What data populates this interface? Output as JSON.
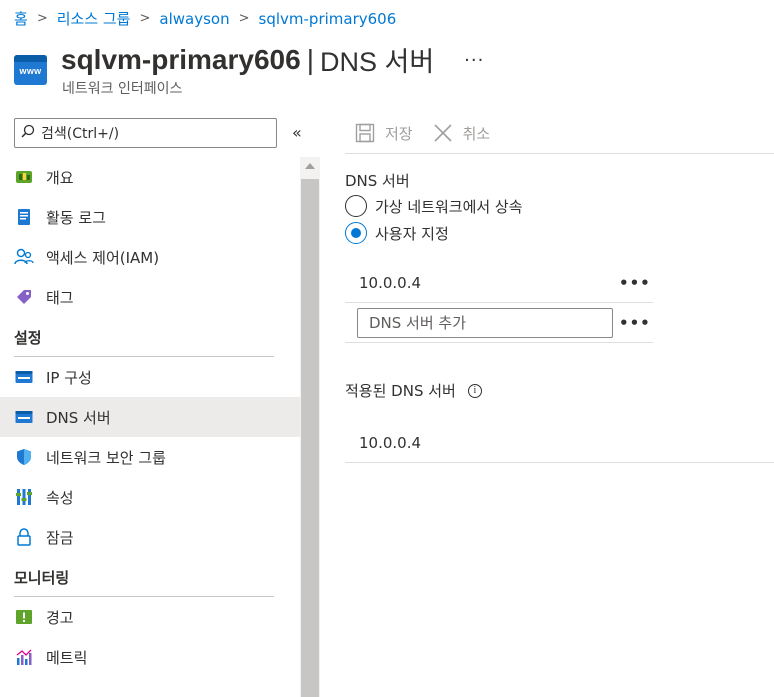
{
  "breadcrumb": {
    "items": [
      "홈",
      "리소스 그룹",
      "alwayson",
      "sqlvm-primary606"
    ]
  },
  "header": {
    "icon_text": "www",
    "resource_name": "sqlvm-primary606",
    "separator": "|",
    "page_name": "DNS 서버",
    "more": "···",
    "subtitle": "네트워크 인터페이스"
  },
  "sidebar": {
    "search_placeholder": "검색(Ctrl+/)",
    "collapse": "«",
    "top_items": [
      {
        "label": "개요",
        "icon": "overview-icon"
      },
      {
        "label": "활동 로그",
        "icon": "activity-log-icon"
      },
      {
        "label": "액세스 제어(IAM)",
        "icon": "iam-icon"
      },
      {
        "label": "태그",
        "icon": "tag-icon"
      }
    ],
    "settings_title": "설정",
    "settings_items": [
      {
        "label": "IP 구성",
        "icon": "ip-config-icon"
      },
      {
        "label": "DNS 서버",
        "icon": "dns-server-icon",
        "active": true
      },
      {
        "label": "네트워크 보안 그룹",
        "icon": "nsg-icon"
      },
      {
        "label": "속성",
        "icon": "properties-icon"
      },
      {
        "label": "잠금",
        "icon": "lock-icon"
      }
    ],
    "monitoring_title": "모니터링",
    "monitoring_items": [
      {
        "label": "경고",
        "icon": "alerts-icon"
      },
      {
        "label": "메트릭",
        "icon": "metrics-icon"
      }
    ]
  },
  "toolbar": {
    "save": "저장",
    "cancel": "취소"
  },
  "dns": {
    "section_label": "DNS 서버",
    "options": [
      "가상 네트워크에서 상속",
      "사용자 지정"
    ],
    "selected_option": "사용자 지정",
    "servers": [
      "10.0.0.4"
    ],
    "add_placeholder": "DNS 서버 추가",
    "row_menu": "•••",
    "applied_label": "적용된 DNS 서버",
    "applied_info": "i",
    "applied_servers": [
      "10.0.0.4"
    ]
  },
  "colors": {
    "accent": "#0078d4",
    "active_nav_bg": "#edebe9",
    "disabled_text": "#a19f9d"
  }
}
